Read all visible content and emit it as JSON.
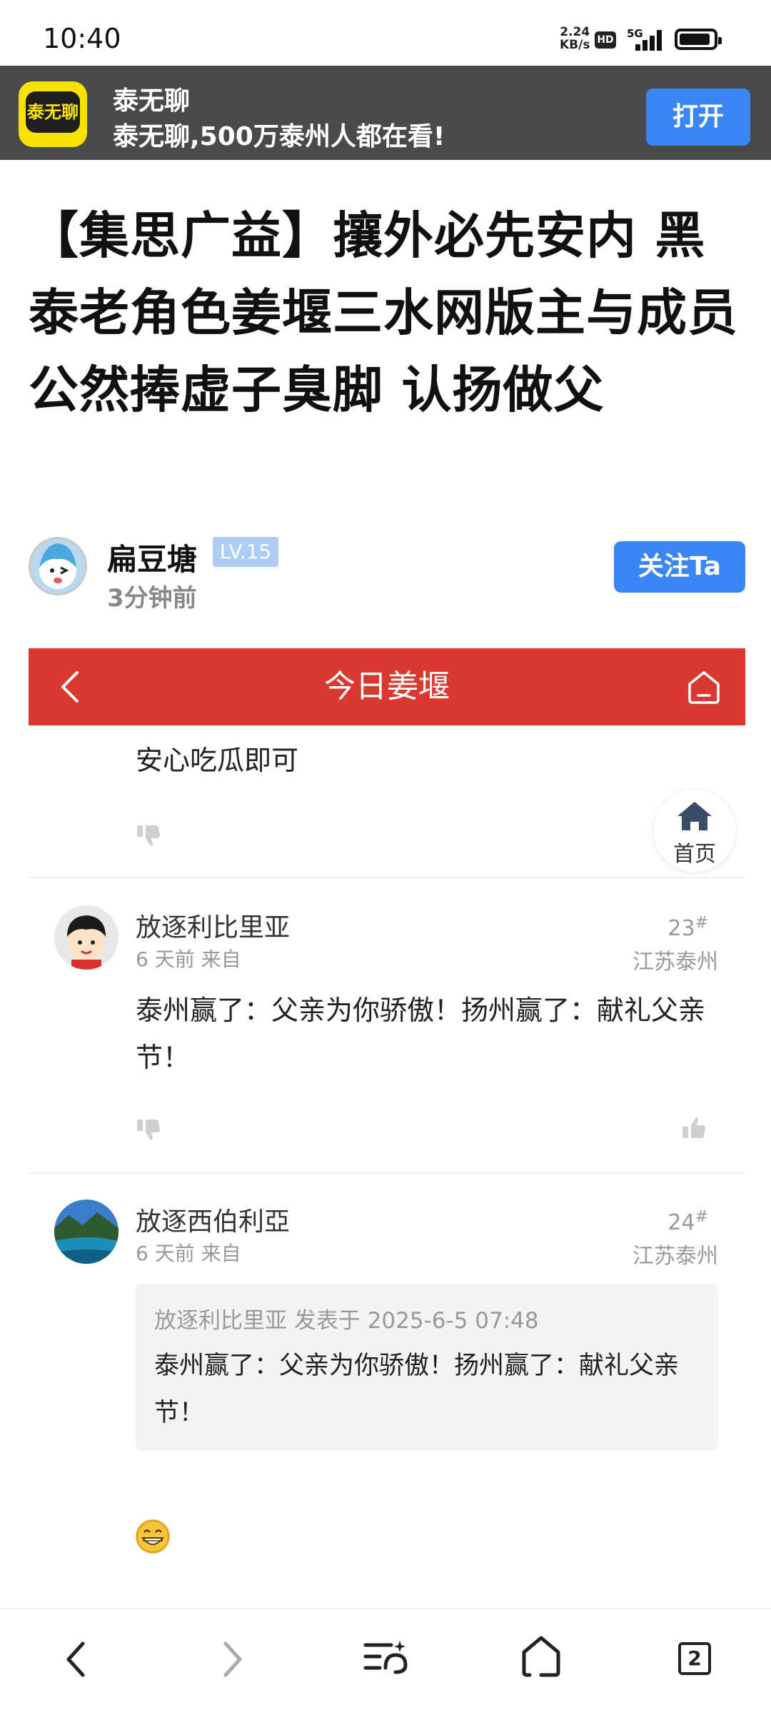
{
  "status_bar": {
    "time": "10:40",
    "net_speed_value": "2.24",
    "net_speed_unit": "KB/s",
    "hd": "HD",
    "network": "5G"
  },
  "app_banner": {
    "logo_text": "泰无聊",
    "app_name": "泰无聊",
    "slogan": "泰无聊,500万泰州人都在看!",
    "open_label": "打开"
  },
  "article": {
    "title": "【集思广益】攘外必先安内 黑泰老角色姜堰三水网版主与成员公然捧虚子臭脚 认扬做父",
    "author": "扁豆塘",
    "level": "LV.15",
    "time": "3分钟前",
    "follow_label": "关注Ta"
  },
  "forum": {
    "title": "今日姜堰",
    "home_float_label": "首页"
  },
  "comments": [
    {
      "text": "安心吃瓜即可"
    },
    {
      "name": "放逐利比里亚",
      "meta": "6 天前 来自",
      "floor": "23",
      "floor_mark": "#",
      "location": "江苏泰州",
      "text": "泰州赢了：父亲为你骄傲！扬州赢了：献礼父亲节！"
    },
    {
      "name": "放逐西伯利亞",
      "meta": "6 天前 来自",
      "floor": "24",
      "floor_mark": "#",
      "location": "江苏泰州",
      "quote_meta": "放逐利比里亚 发表于 2025-6-5 07:48",
      "quote_text": "泰州赢了：父亲为你骄傲！扬州赢了：献礼父亲节！"
    }
  ],
  "bottom_nav": {
    "tab_count": "2"
  }
}
